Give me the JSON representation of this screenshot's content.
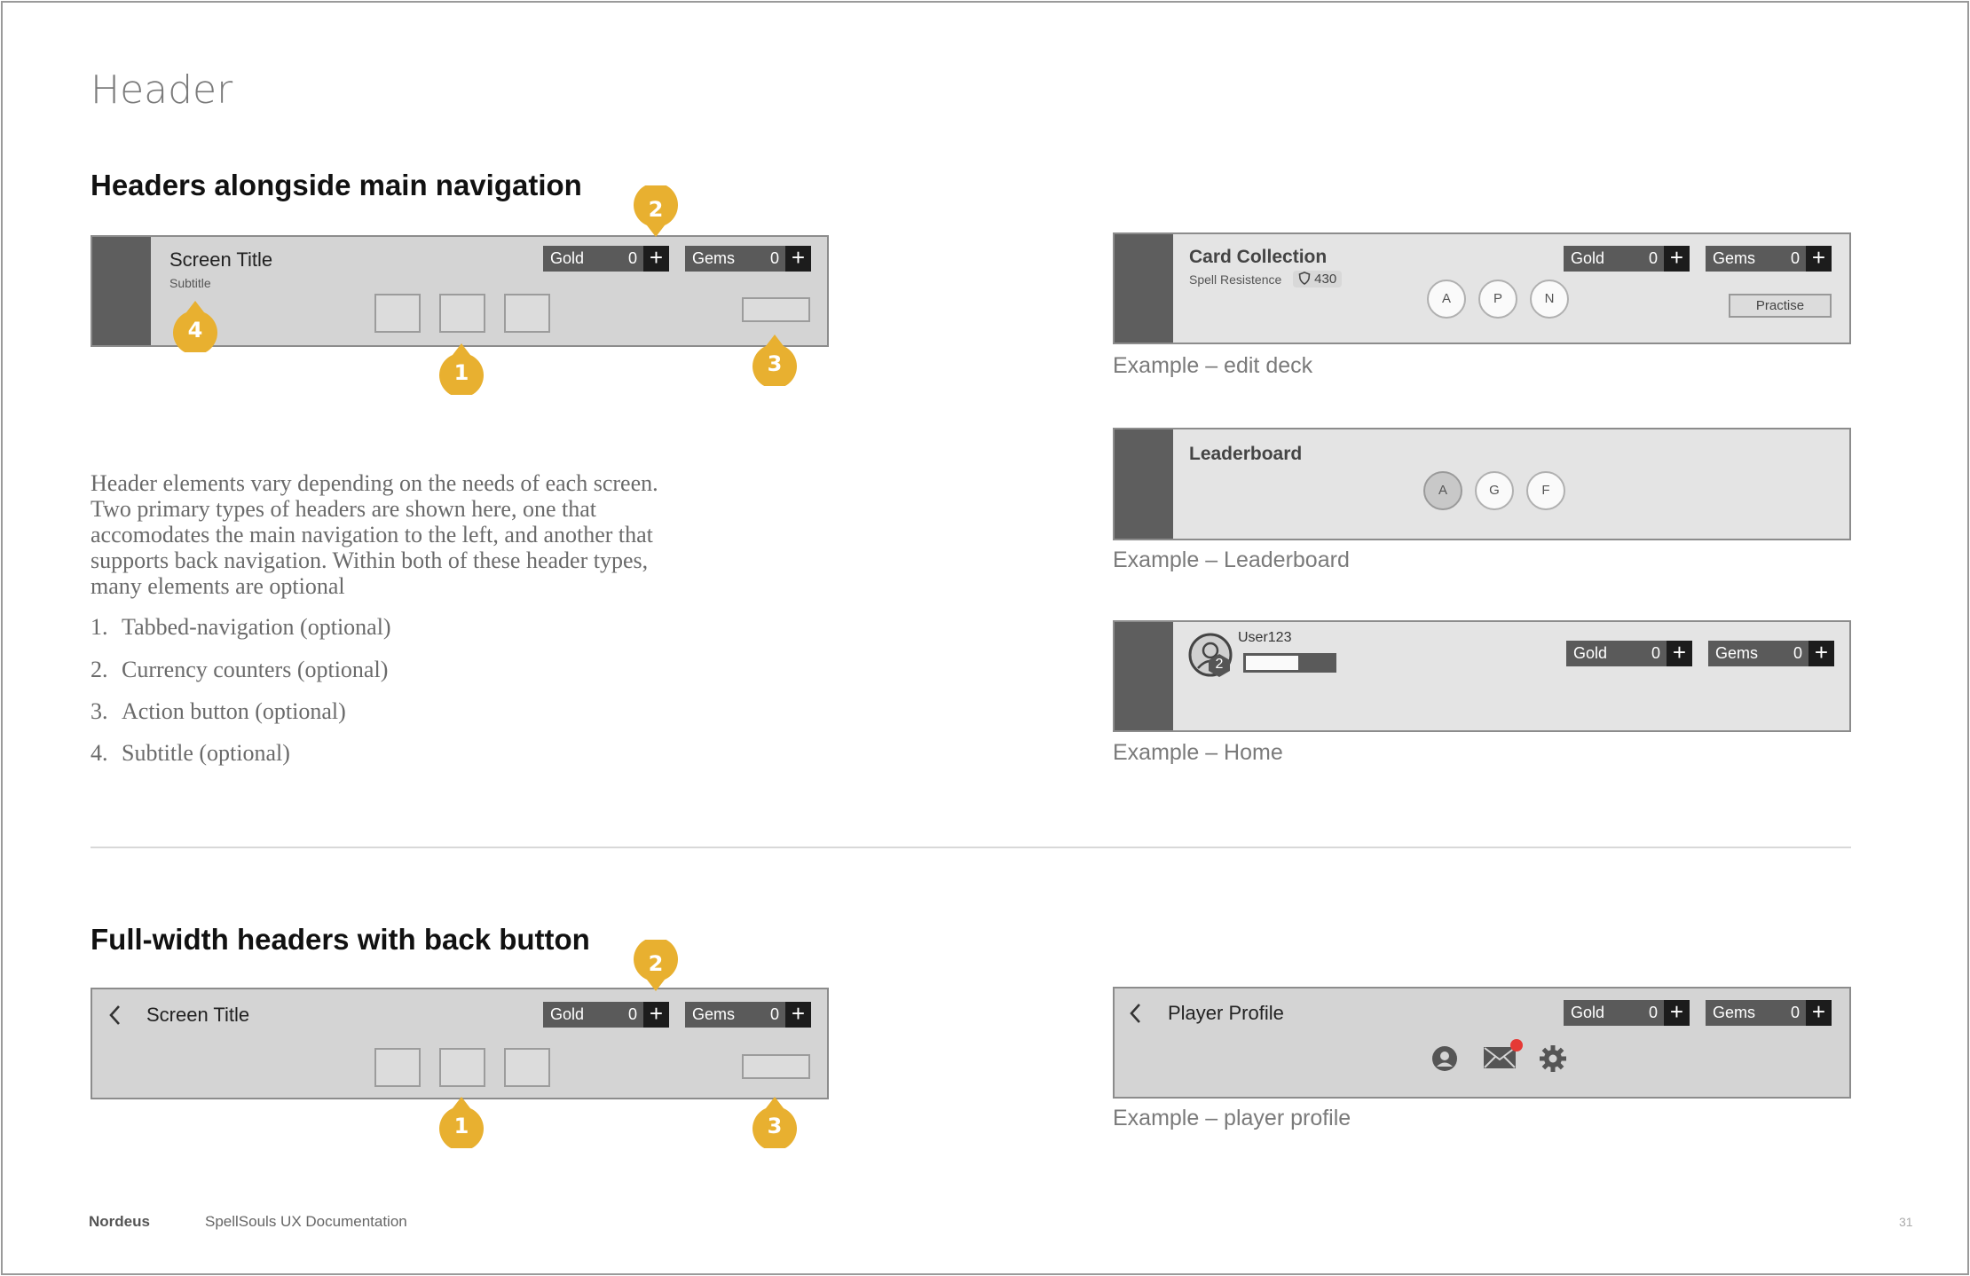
{
  "page": {
    "title": "Header",
    "section1_title": "Headers alongside main navigation",
    "section2_title": "Full-width headers with back button",
    "description": "Header elements vary depending on the needs of each screen. Two primary types of headers are shown here, one that accomodates the main navigation to the left, and another that supports back navigation. Within both of these header types, many elements are optional",
    "list": [
      {
        "num": "1.",
        "text": "Tabbed-navigation (optional)"
      },
      {
        "num": "2.",
        "text": "Currency counters (optional)"
      },
      {
        "num": "3.",
        "text": "Action button (optional)"
      },
      {
        "num": "4.",
        "text": "Subtitle (optional)"
      }
    ],
    "footer_brand": "Nordeus",
    "footer_doc": "SpellSouls UX Documentation",
    "page_number": "31",
    "accent_color": "#E8B030"
  },
  "mockup_main": {
    "title": "Screen Title",
    "subtitle": "Subtitle",
    "gold_label": "Gold",
    "gold_value": "0",
    "gems_label": "Gems",
    "gems_value": "0",
    "plus": "+"
  },
  "callouts": {
    "one": "1",
    "two": "2",
    "three": "3",
    "four": "4"
  },
  "example_edit_deck": {
    "title": "Card Collection",
    "subtitle": "Spell Resistence",
    "badge_value": "430",
    "tabs": [
      "A",
      "P",
      "N"
    ],
    "action_label": "Practise",
    "gold_label": "Gold",
    "gold_value": "0",
    "gems_label": "Gems",
    "gems_value": "0",
    "caption": "Example – edit deck"
  },
  "example_leaderboard": {
    "title": "Leaderboard",
    "tabs": [
      "A",
      "G",
      "F"
    ],
    "caption": "Example – Leaderboard"
  },
  "example_home": {
    "username": "User123",
    "level": "2",
    "xp_progress": 0.6,
    "gold_label": "Gold",
    "gold_value": "0",
    "gems_label": "Gems",
    "gems_value": "0",
    "caption": "Example – Home"
  },
  "mockup_back": {
    "back_icon": "chevron-left-icon",
    "title": "Screen Title",
    "gold_label": "Gold",
    "gold_value": "0",
    "gems_label": "Gems",
    "gems_value": "0"
  },
  "example_profile": {
    "back_icon": "chevron-left-icon",
    "title": "Player Profile",
    "icons": [
      "user-icon",
      "mail-icon",
      "gear-icon"
    ],
    "notification_color": "#E53935",
    "gold_label": "Gold",
    "gold_value": "0",
    "gems_label": "Gems",
    "gems_value": "0",
    "caption": "Example – player profile"
  }
}
